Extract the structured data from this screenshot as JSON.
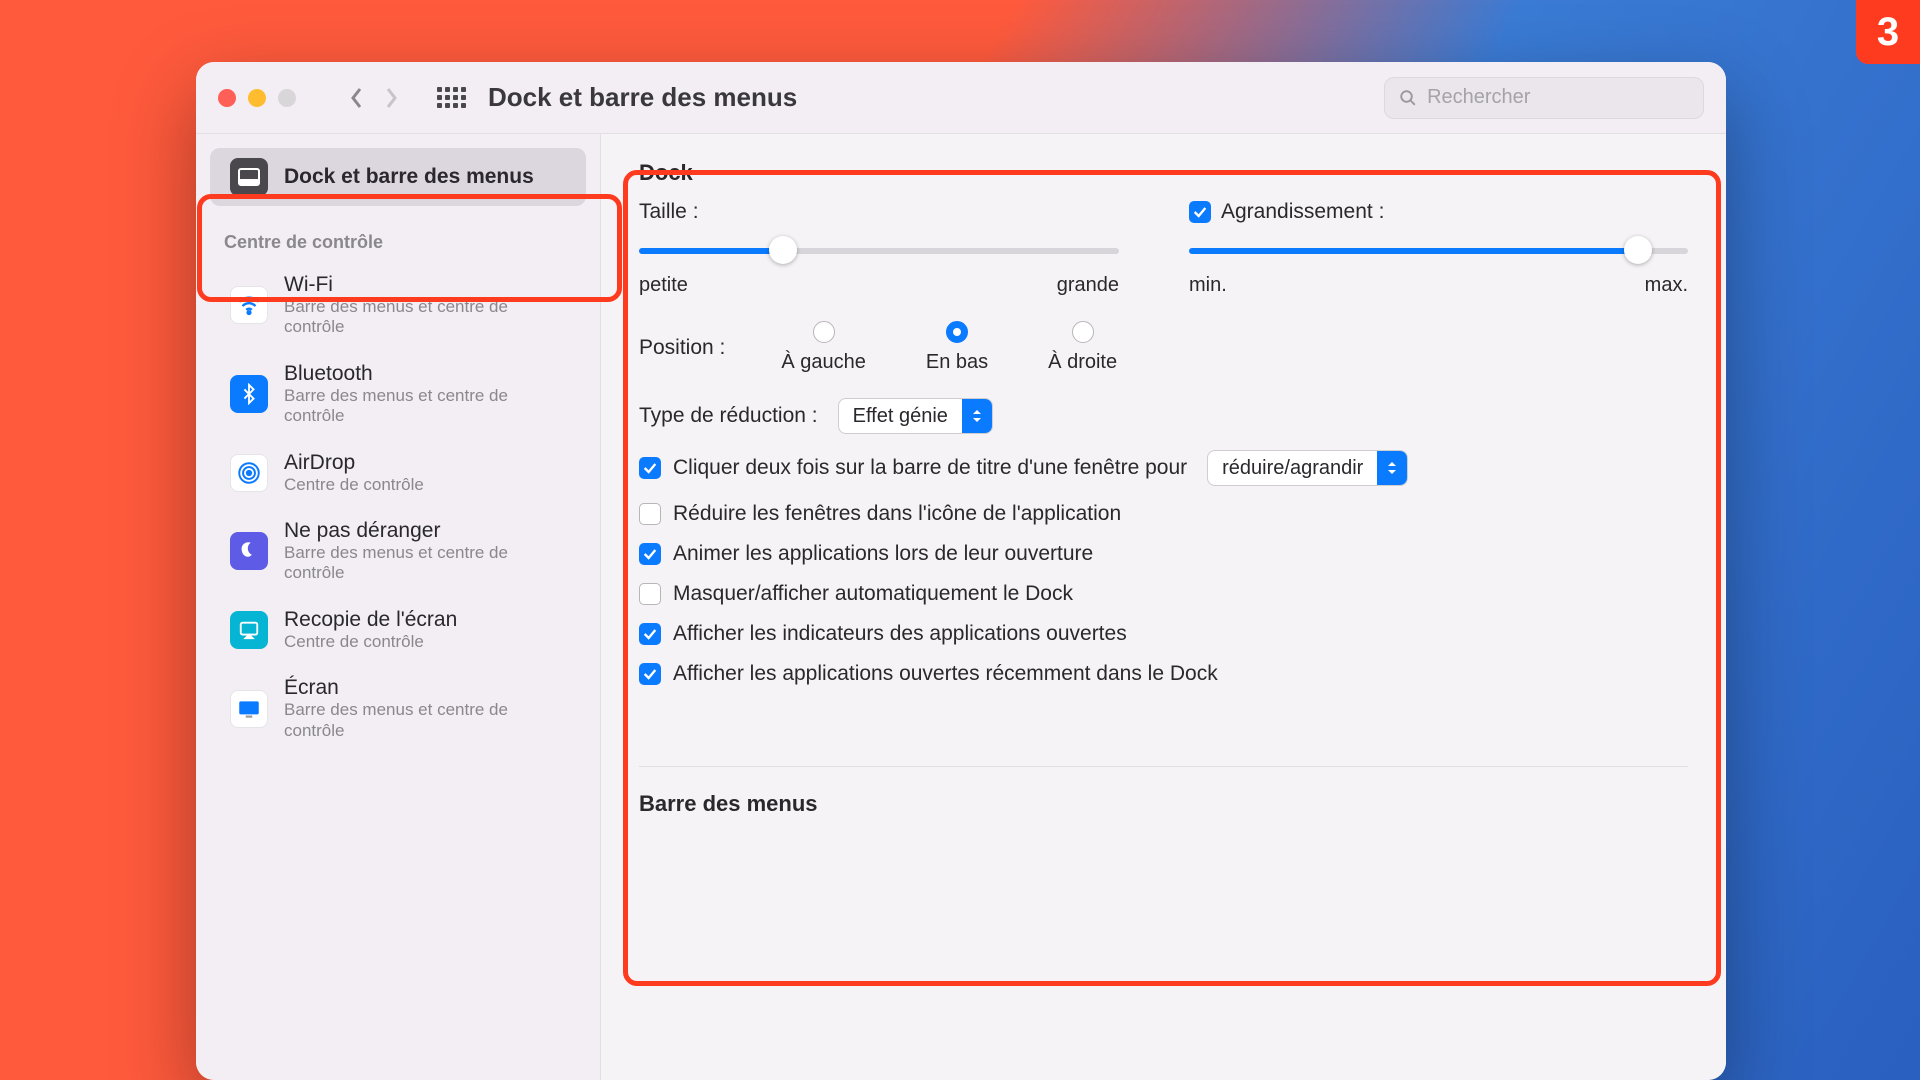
{
  "step_badge": "3",
  "toolbar": {
    "title": "Dock et barre des menus",
    "search_placeholder": "Rechercher"
  },
  "sidebar": {
    "selected": {
      "name": "Dock et barre des menus"
    },
    "section_title": "Centre de contrôle",
    "items": [
      {
        "name": "Wi-Fi",
        "sub": "Barre des menus et centre de contrôle"
      },
      {
        "name": "Bluetooth",
        "sub": "Barre des menus et centre de contrôle"
      },
      {
        "name": "AirDrop",
        "sub": "Centre de contrôle"
      },
      {
        "name": "Ne pas déranger",
        "sub": "Barre des menus et centre de contrôle"
      },
      {
        "name": "Recopie de l'écran",
        "sub": "Centre de contrôle"
      },
      {
        "name": "Écran",
        "sub": "Barre des menus et centre de contrôle"
      }
    ]
  },
  "content": {
    "heading": "Dock",
    "size_label": "Taille :",
    "size_min": "petite",
    "size_max": "grande",
    "size_value_pct": 30,
    "magnification_label": "Agrandissement :",
    "magnification_checked": true,
    "magnification_min": "min.",
    "magnification_max": "max.",
    "magnification_value_pct": 90,
    "position_label": "Position :",
    "position_options": [
      "À gauche",
      "En bas",
      "À droite"
    ],
    "position_selected": 1,
    "minimize_label": "Type de réduction :",
    "minimize_value": "Effet génie",
    "doubleclick_label": "Cliquer deux fois sur la barre de titre d'une fenêtre pour",
    "doubleclick_value": "réduire/agrandir",
    "doubleclick_checked": true,
    "minimize_into_icon_label": "Réduire les fenêtres dans l'icône de l'application",
    "minimize_into_icon_checked": false,
    "animate_label": "Animer les applications lors de leur ouverture",
    "animate_checked": true,
    "autohide_label": "Masquer/afficher automatiquement le Dock",
    "autohide_checked": false,
    "indicators_label": "Afficher les indicateurs des applications ouvertes",
    "indicators_checked": true,
    "recent_label": "Afficher les applications ouvertes récemment dans le Dock",
    "recent_checked": true,
    "menubar_heading": "Barre des menus"
  }
}
